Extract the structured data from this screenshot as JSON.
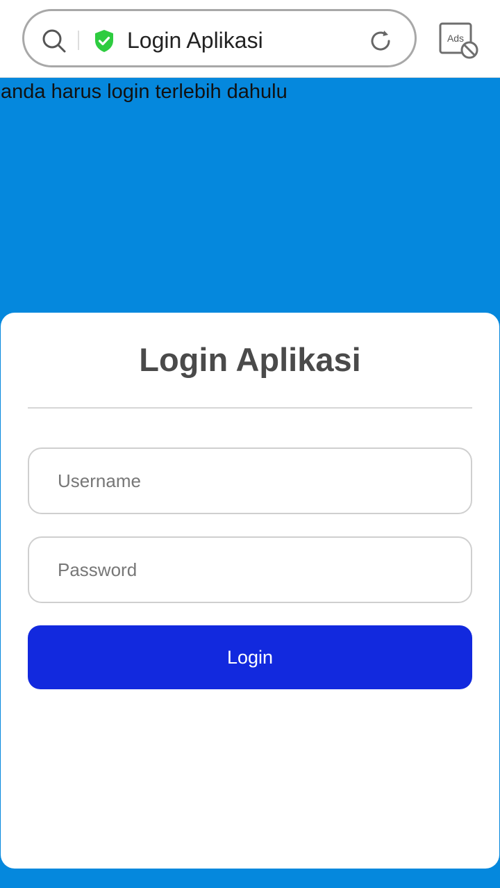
{
  "browser": {
    "url_text": "Login Aplikasi",
    "ads_badge": "Ads",
    "icons": {
      "search": "search-icon",
      "secure": "shield-check-icon",
      "reload": "reload-icon",
      "ads_block": "ads-block-icon"
    },
    "colors": {
      "shield": "#2ecc40",
      "pill_border": "#a8a8a8"
    }
  },
  "page": {
    "notice": "anda harus login terlebih dahulu",
    "background_color": "#0588dd"
  },
  "login_card": {
    "title": "Login Aplikasi",
    "username_placeholder": "Username",
    "password_placeholder": "Password",
    "login_label": "Login",
    "button_color": "#1229de"
  }
}
